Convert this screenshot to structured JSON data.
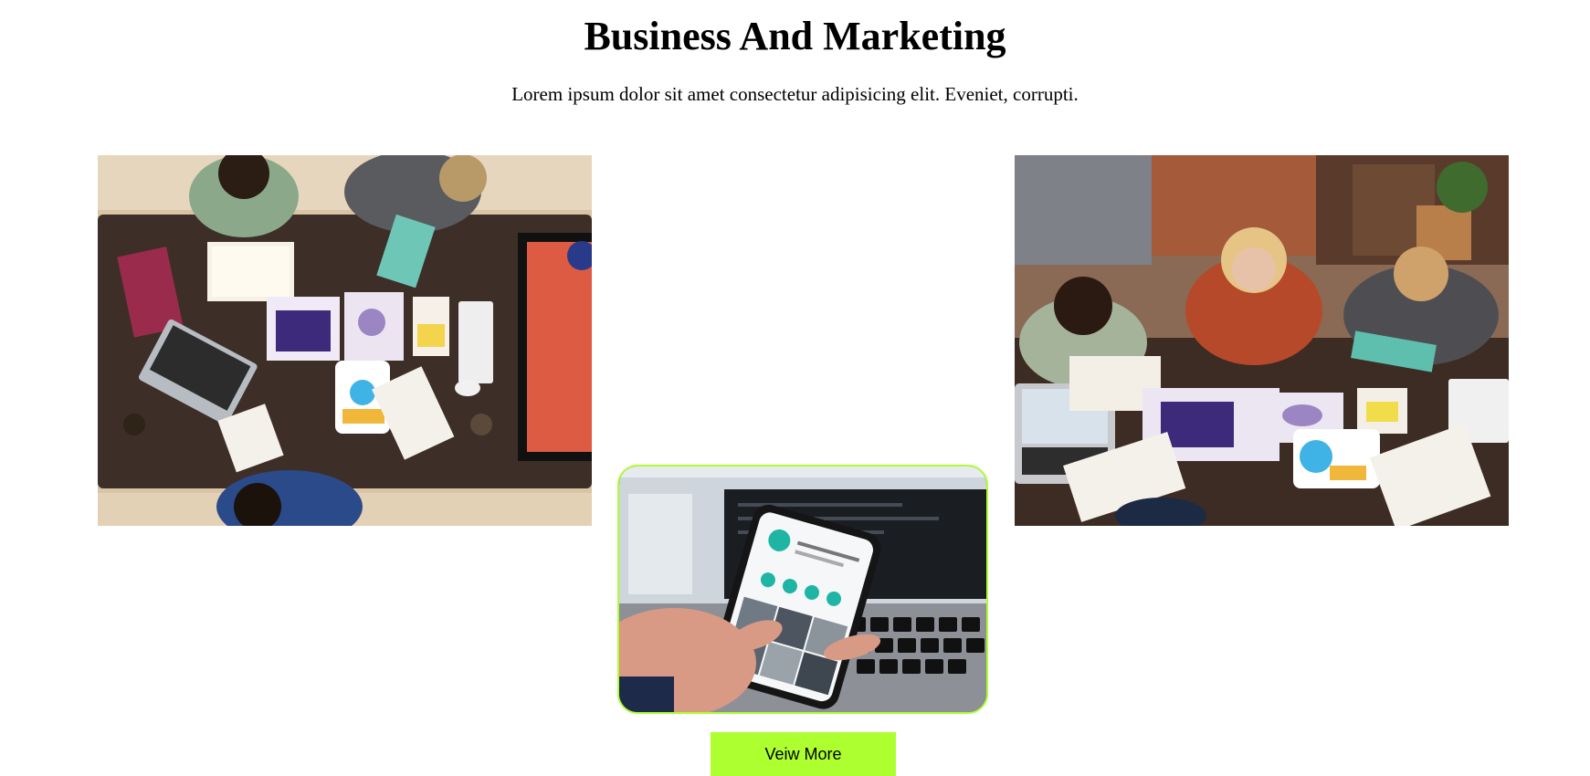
{
  "header": {
    "title": "Business And Marketing",
    "subtitle": "Lorem ipsum dolor sit amet consectetur adipisicing elit. Eveniet, corrupti."
  },
  "gallery": {
    "images": [
      {
        "name": "team-desk-photo",
        "subject": "team working around desk with laptop, charts and tablet"
      },
      {
        "name": "phone-photo",
        "subject": "hand holding smartphone with social media app in front of laptop"
      },
      {
        "name": "team-meeting-photo",
        "subject": "team of four reviewing charts and tablet at table"
      }
    ]
  },
  "cta": {
    "label": "Veiw More"
  },
  "colors": {
    "accent": "#adff2f",
    "text": "#000000",
    "background": "#ffffff"
  }
}
